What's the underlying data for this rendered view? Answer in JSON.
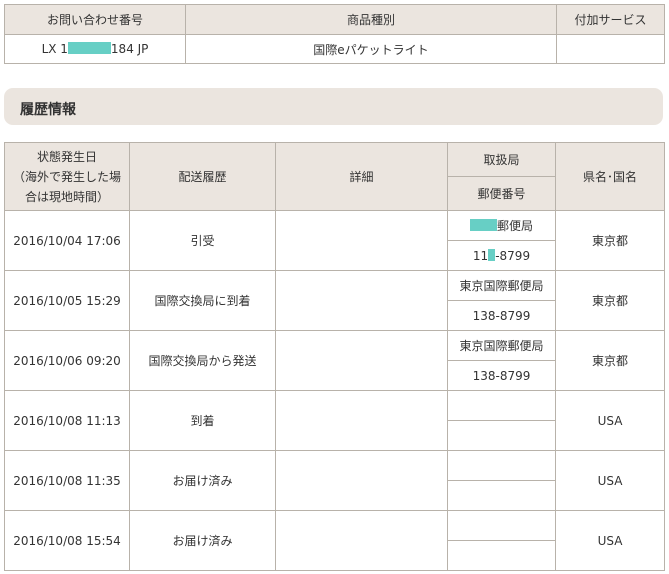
{
  "summary": {
    "headers": {
      "tracking_no": "お問い合わせ番号",
      "item_type": "商品種別",
      "extra_service": "付加サービス"
    },
    "tracking_prefix": "LX 1",
    "tracking_suffix": "184 JP",
    "item_type_value": "国際eパケットライト",
    "extra_service_value": ""
  },
  "section": {
    "title": "履歴情報"
  },
  "history": {
    "headers": {
      "status_date_line1": "状態発生日",
      "status_date_line2": "（海外で発生した場",
      "status_date_line3": "合は現地時間）",
      "delivery_history": "配送履歴",
      "detail": "詳細",
      "office": "取扱局",
      "postal_code": "郵便番号",
      "prefecture_country": "県名･国名"
    },
    "rows": [
      {
        "date": "2016/10/04 17:06",
        "event": "引受",
        "detail": "",
        "office_suffix": "郵便局",
        "postal_prefix": "11",
        "postal_suffix": "-8799",
        "region": "東京都"
      },
      {
        "date": "2016/10/05 15:29",
        "event": "国際交換局に到着",
        "detail": "",
        "office": "東京国際郵便局",
        "postal": "138-8799",
        "region": "東京都"
      },
      {
        "date": "2016/10/06 09:20",
        "event": "国際交換局から発送",
        "detail": "",
        "office": "東京国際郵便局",
        "postal": "138-8799",
        "region": "東京都"
      },
      {
        "date": "2016/10/08 11:13",
        "event": "到着",
        "detail": "",
        "office": "",
        "postal": "",
        "region": "USA"
      },
      {
        "date": "2016/10/08 11:35",
        "event": "お届け済み",
        "detail": "",
        "office": "",
        "postal": "",
        "region": "USA"
      },
      {
        "date": "2016/10/08 15:54",
        "event": "お届け済み",
        "detail": "",
        "office": "",
        "postal": "",
        "region": "USA"
      }
    ]
  },
  "colors": {
    "header_bg": "#ebe5df",
    "border": "#b8b2aa",
    "redaction": "#67cfc5"
  }
}
